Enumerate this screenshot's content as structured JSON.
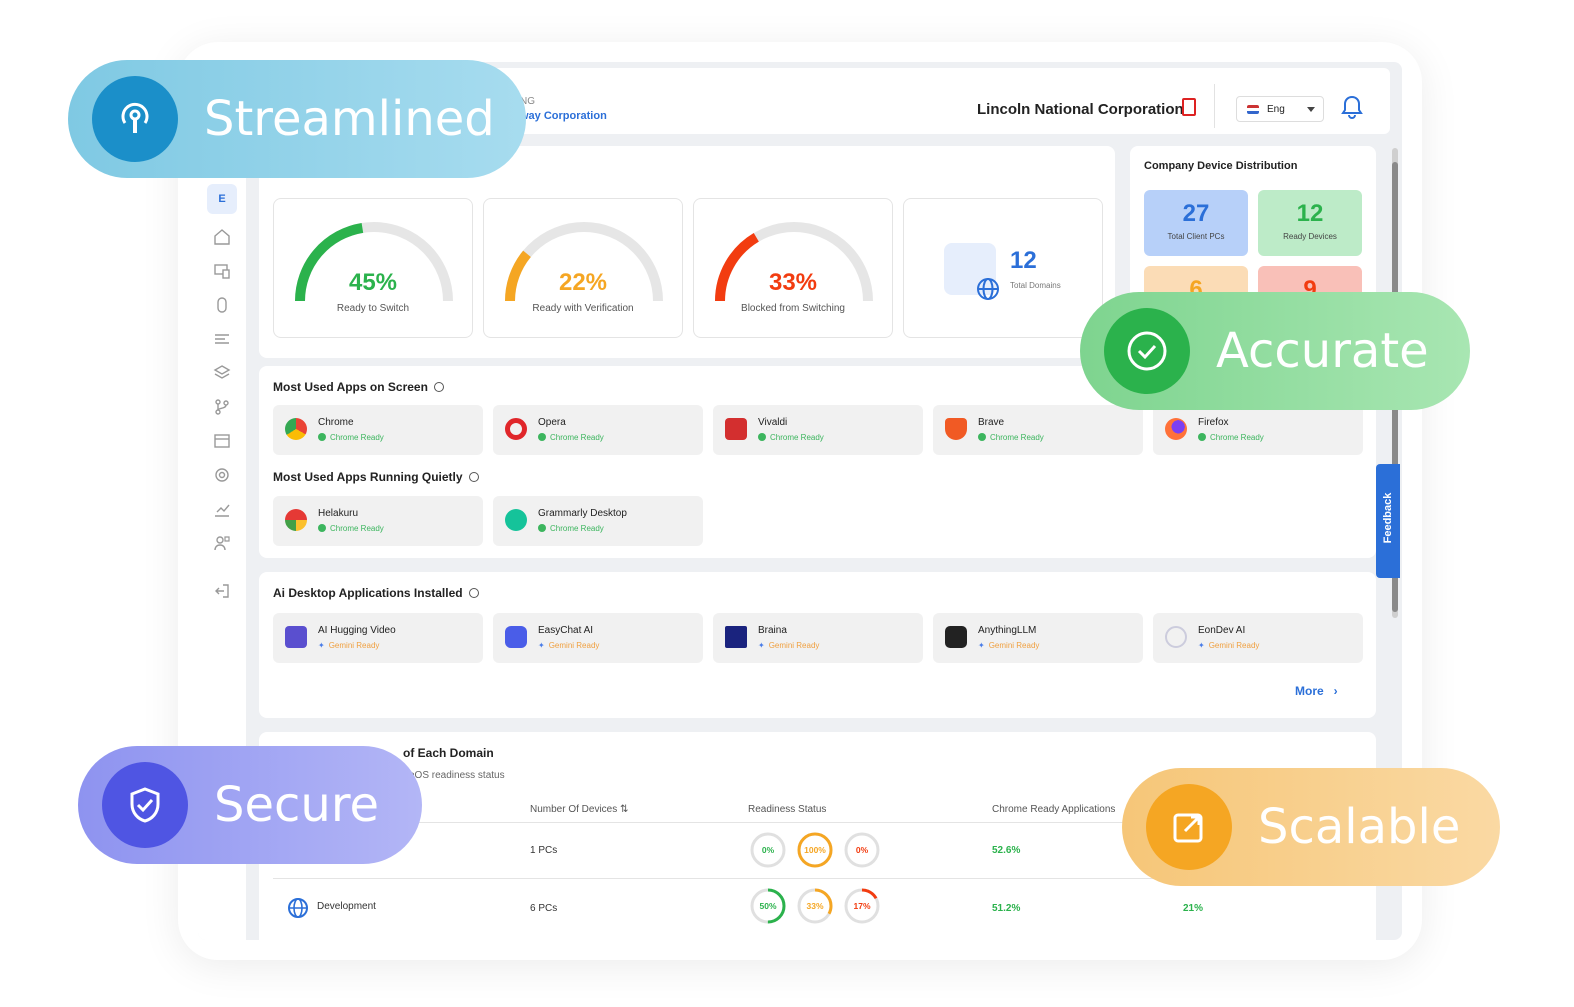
{
  "header": {
    "logo_sub": "NG",
    "logo_main": "way Corporation",
    "company": "Lincoln National Corporation",
    "lang": "Eng"
  },
  "sidebar": {
    "badge": "E"
  },
  "gauges": [
    {
      "pct": "45%",
      "label": "Ready to Switch",
      "value": 0.45,
      "color": "#2bb24c"
    },
    {
      "pct": "22%",
      "label": "Ready with Verification",
      "value": 0.22,
      "color": "#f5a623"
    },
    {
      "pct": "33%",
      "label": "Blocked from Switching",
      "value": 0.33,
      "color": "#f23c10"
    }
  ],
  "domains": {
    "count": "12",
    "label": "Total Domains"
  },
  "distribution": {
    "title": "Company Device Distribution",
    "tiles": [
      {
        "n": "27",
        "l": "Total Client PCs",
        "bg": "#b7d0f9",
        "color": "#2b6fd8"
      },
      {
        "n": "12",
        "l": "Ready Devices",
        "bg": "#bdebc8",
        "color": "#2bb24c"
      },
      {
        "n": "6",
        "l": "",
        "bg": "#fbdcb6",
        "color": "#f5a623"
      },
      {
        "n": "9",
        "l": "",
        "bg": "#f9c0b8",
        "color": "#f23c10"
      }
    ]
  },
  "sections": {
    "screen": "Most Used Apps on Screen",
    "quiet": "Most Used Apps Running Quietly",
    "ai": "Ai Desktop Applications Installed",
    "domain": "of Each Domain",
    "domain_sub": "eOS readiness status",
    "more": "More"
  },
  "screen_apps": [
    {
      "name": "Chrome",
      "status": "Chrome Ready"
    },
    {
      "name": "Opera",
      "status": "Chrome Ready"
    },
    {
      "name": "Vivaldi",
      "status": "Chrome Ready"
    },
    {
      "name": "Brave",
      "status": "Chrome Ready"
    },
    {
      "name": "Firefox",
      "status": "Chrome Ready"
    }
  ],
  "quiet_apps": [
    {
      "name": "Helakuru",
      "status": "Chrome Ready"
    },
    {
      "name": "Grammarly Desktop",
      "status": "Chrome Ready"
    }
  ],
  "ai_apps": [
    {
      "name": "AI Hugging Video",
      "status": "Gemini Ready"
    },
    {
      "name": "EasyChat AI",
      "status": "Gemini Ready"
    },
    {
      "name": "Braina",
      "status": "Gemini Ready"
    },
    {
      "name": "AnythingLLM",
      "status": "Gemini Ready"
    },
    {
      "name": "EonDev AI",
      "status": "Gemini Ready"
    }
  ],
  "table": {
    "headers": {
      "devices": "Number Of Devices ⇅",
      "readiness": "Readiness Status",
      "chrome": "Chrome Ready Applications"
    },
    "rows": [
      {
        "domain": "",
        "devices": "1 PCs",
        "r1": "0%",
        "r2": "100%",
        "r3": "0%",
        "v1": 0,
        "v2": 1,
        "v3": 0,
        "chrome": "52.6%",
        "extra": ""
      },
      {
        "domain": "Development",
        "devices": "6 PCs",
        "r1": "50%",
        "r2": "33%",
        "r3": "17%",
        "v1": 0.5,
        "v2": 0.33,
        "v3": 0.17,
        "chrome": "51.2%",
        "extra": "21%"
      }
    ]
  },
  "feedback": "Feedback",
  "pills": {
    "streamlined": "Streamlined",
    "accurate": "Accurate",
    "secure": "Secure",
    "scalable": "Scalable"
  }
}
